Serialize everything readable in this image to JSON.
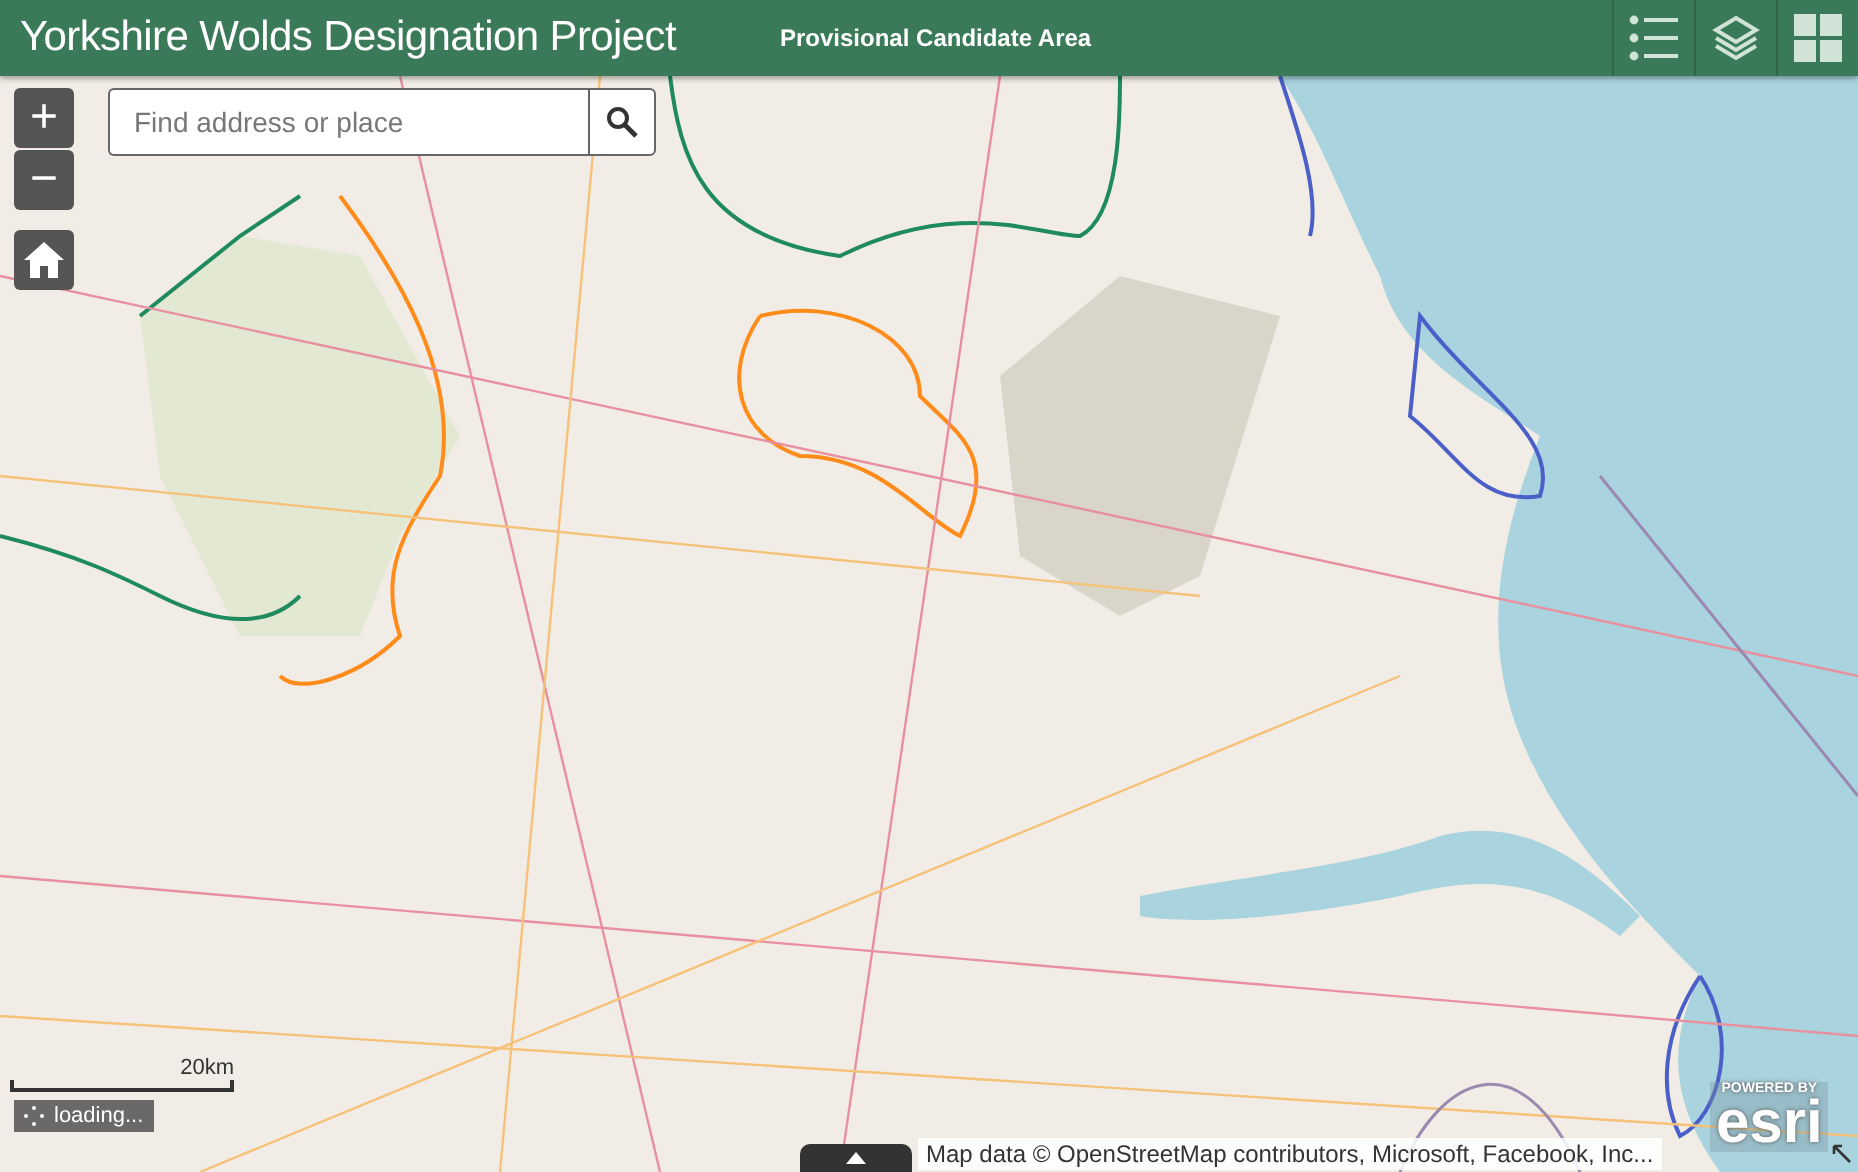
{
  "header": {
    "title": "Yorkshire Wolds Designation Project",
    "subtitle": "Provisional Candidate Area"
  },
  "zoom": {
    "in": "+",
    "out": "−"
  },
  "search": {
    "placeholder": "Find address or place"
  },
  "scale": {
    "label": "20km"
  },
  "status": {
    "text": "loading..."
  },
  "attribution": "Map data © OpenStreetMap contributors, Microsoft, Facebook, Inc...",
  "logo": {
    "top": "POWERED BY",
    "name": "esri"
  }
}
